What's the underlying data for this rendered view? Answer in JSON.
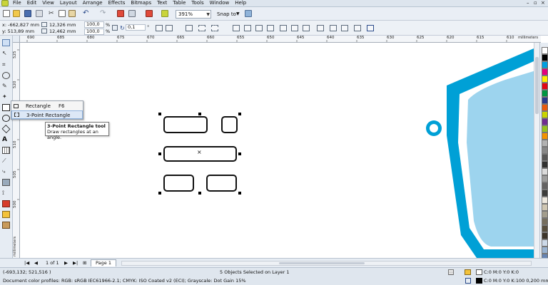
{
  "menu": {
    "items": [
      "File",
      "Edit",
      "View",
      "Layout",
      "Arrange",
      "Effects",
      "Bitmaps",
      "Text",
      "Table",
      "Tools",
      "Window",
      "Help"
    ],
    "window_controls": [
      "–",
      "▫",
      "×"
    ]
  },
  "toolbar": {
    "zoom": "391%",
    "snap_to": "Snap to"
  },
  "property_bar": {
    "x": "x: -662,827 mm",
    "y": "y: 513,89 mm",
    "width": "12,326 mm",
    "height": "12,462 mm",
    "scale_x": "100,0",
    "scale_y": "100,0",
    "percent": "%",
    "angle": "0,1",
    "angle_unit": "°"
  },
  "ruler": {
    "h_ticks": [
      "690",
      "685",
      "680",
      "675",
      "670",
      "665",
      "660",
      "655",
      "650",
      "645",
      "640",
      "635",
      "630",
      "625",
      "620",
      "615",
      "610"
    ],
    "unit": "millimeters",
    "v_ticks": [
      "525",
      "520",
      "515",
      "510",
      "505",
      "500"
    ],
    "v_unit": "millimeters"
  },
  "flyout": {
    "items": [
      {
        "label": "Rectangle",
        "shortcut": "F6"
      },
      {
        "label": "3-Point Rectangle",
        "shortcut": ""
      }
    ]
  },
  "tooltip": {
    "title": "3-Point Rectangle tool",
    "description": "Draw rectangles at an angle."
  },
  "page_nav": {
    "counter": "1 of 1",
    "page_tab": "Page 1"
  },
  "status": {
    "coords": "(-693,132; 521,516 )",
    "selection": "5 Objects Selected on Layer 1",
    "profiles": "Document color profiles: RGB: sRGB IEC61966-2.1; CMYK: ISO Coated v2 (ECI); Grayscale: Dot Gain 15%",
    "fill": "C:0 M:0 Y:0 K:0",
    "outline": "C:0 M:0 Y:0 K:100  0,200 mm"
  },
  "colors": {
    "accent_blue": "#00a0d6",
    "light_blue": "#9dd4ee",
    "palette": [
      "#ffffff",
      "#000000",
      "#00a0e0",
      "#e4007d",
      "#ffec00",
      "#e30613",
      "#009640",
      "#2a3a8c",
      "#ea5b0c",
      "#c8d400",
      "#6f2c91",
      "#95c11f",
      "#f39200",
      "#b2b2b2",
      "#878787",
      "#575757",
      "#313131",
      "#dadada",
      "#9d9d9c",
      "#646363",
      "#3c3c3b",
      "#ede8de",
      "#cfc6b2",
      "#a29d8d",
      "#756e5e",
      "#584f3e",
      "#3d352a",
      "#ccd9e8",
      "#99b3d1",
      "#6684b3"
    ]
  }
}
